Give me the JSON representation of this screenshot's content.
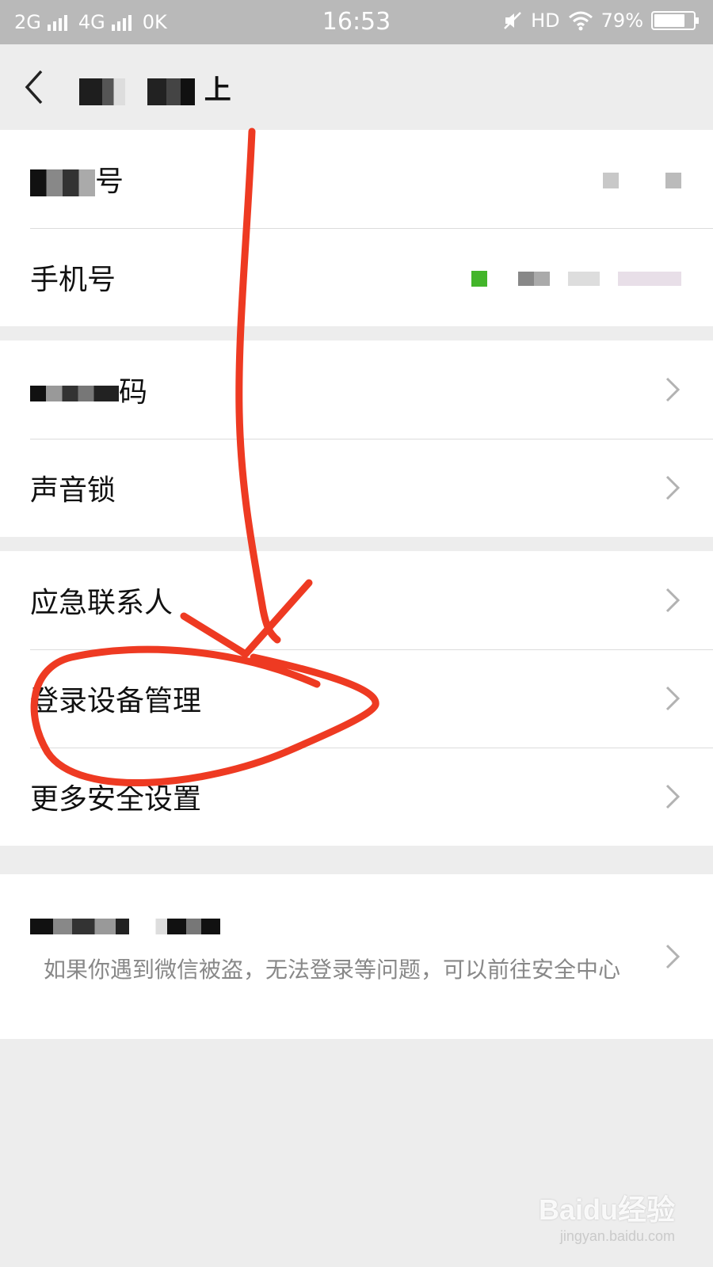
{
  "status_bar": {
    "network1": "2G",
    "network2": "4G",
    "carrier_partial": "0K",
    "time": "16:53",
    "hd": "HD",
    "battery": "79%",
    "battery_level": 0.79
  },
  "header": {
    "title_visible_suffix": "上"
  },
  "group1": {
    "row1_suffix": "号",
    "row2_label": "手机号"
  },
  "group2": {
    "row1_suffix": "码",
    "row2_label": "声音锁"
  },
  "group3": {
    "row1_label": "应急联系人",
    "row2_label": "登录设备管理",
    "row3_label": "更多安全设置"
  },
  "security_center": {
    "description": "如果你遇到微信被盗，无法登录等问题，可以前往安全中心"
  },
  "watermark": {
    "main": "Baidu经验",
    "sub": "jingyan.baidu.com"
  },
  "colors": {
    "annotation": "#ee3a22",
    "statusbar": "#b9b9b9",
    "background": "#ededed",
    "green_dot": "#43b52a"
  },
  "icons": [
    "back-arrow-icon",
    "chevron-right-icon",
    "wifi-icon",
    "mute-icon",
    "battery-icon",
    "signal-icon"
  ]
}
